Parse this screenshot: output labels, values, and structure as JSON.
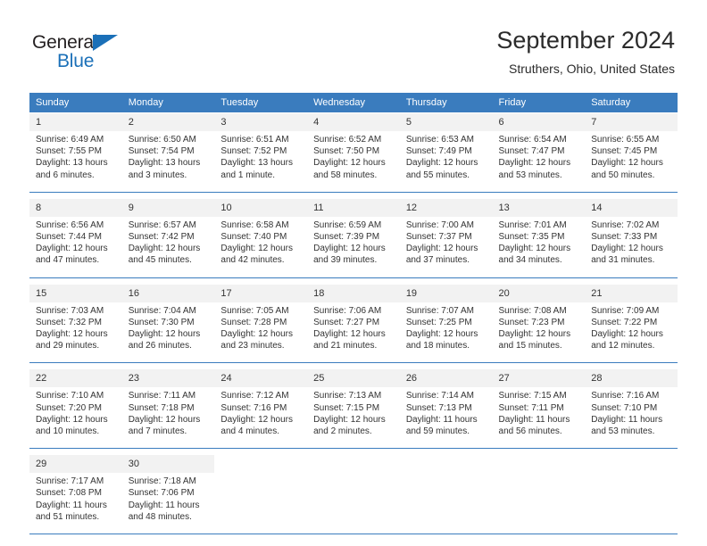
{
  "logo": {
    "text_primary": "General",
    "text_secondary": "Blue",
    "triangle_icon": "triangle-icon",
    "brand_color": "#1b70b8"
  },
  "header": {
    "title": "September 2024",
    "subtitle": "Struthers, Ohio, United States"
  },
  "theme": {
    "header_bg": "#3a7cbe",
    "daynum_bg": "#f2f2f2",
    "cell_bg": "#ffffff",
    "text": "#333333",
    "separator": "#3a7cbe"
  },
  "calendar": {
    "columns": [
      "Sunday",
      "Monday",
      "Tuesday",
      "Wednesday",
      "Thursday",
      "Friday",
      "Saturday"
    ],
    "weeks": [
      [
        {
          "day": "1",
          "sunrise": "Sunrise: 6:49 AM",
          "sunset": "Sunset: 7:55 PM",
          "daylight_1": "Daylight: 13 hours",
          "daylight_2": "and 6 minutes."
        },
        {
          "day": "2",
          "sunrise": "Sunrise: 6:50 AM",
          "sunset": "Sunset: 7:54 PM",
          "daylight_1": "Daylight: 13 hours",
          "daylight_2": "and 3 minutes."
        },
        {
          "day": "3",
          "sunrise": "Sunrise: 6:51 AM",
          "sunset": "Sunset: 7:52 PM",
          "daylight_1": "Daylight: 13 hours",
          "daylight_2": "and 1 minute."
        },
        {
          "day": "4",
          "sunrise": "Sunrise: 6:52 AM",
          "sunset": "Sunset: 7:50 PM",
          "daylight_1": "Daylight: 12 hours",
          "daylight_2": "and 58 minutes."
        },
        {
          "day": "5",
          "sunrise": "Sunrise: 6:53 AM",
          "sunset": "Sunset: 7:49 PM",
          "daylight_1": "Daylight: 12 hours",
          "daylight_2": "and 55 minutes."
        },
        {
          "day": "6",
          "sunrise": "Sunrise: 6:54 AM",
          "sunset": "Sunset: 7:47 PM",
          "daylight_1": "Daylight: 12 hours",
          "daylight_2": "and 53 minutes."
        },
        {
          "day": "7",
          "sunrise": "Sunrise: 6:55 AM",
          "sunset": "Sunset: 7:45 PM",
          "daylight_1": "Daylight: 12 hours",
          "daylight_2": "and 50 minutes."
        }
      ],
      [
        {
          "day": "8",
          "sunrise": "Sunrise: 6:56 AM",
          "sunset": "Sunset: 7:44 PM",
          "daylight_1": "Daylight: 12 hours",
          "daylight_2": "and 47 minutes."
        },
        {
          "day": "9",
          "sunrise": "Sunrise: 6:57 AM",
          "sunset": "Sunset: 7:42 PM",
          "daylight_1": "Daylight: 12 hours",
          "daylight_2": "and 45 minutes."
        },
        {
          "day": "10",
          "sunrise": "Sunrise: 6:58 AM",
          "sunset": "Sunset: 7:40 PM",
          "daylight_1": "Daylight: 12 hours",
          "daylight_2": "and 42 minutes."
        },
        {
          "day": "11",
          "sunrise": "Sunrise: 6:59 AM",
          "sunset": "Sunset: 7:39 PM",
          "daylight_1": "Daylight: 12 hours",
          "daylight_2": "and 39 minutes."
        },
        {
          "day": "12",
          "sunrise": "Sunrise: 7:00 AM",
          "sunset": "Sunset: 7:37 PM",
          "daylight_1": "Daylight: 12 hours",
          "daylight_2": "and 37 minutes."
        },
        {
          "day": "13",
          "sunrise": "Sunrise: 7:01 AM",
          "sunset": "Sunset: 7:35 PM",
          "daylight_1": "Daylight: 12 hours",
          "daylight_2": "and 34 minutes."
        },
        {
          "day": "14",
          "sunrise": "Sunrise: 7:02 AM",
          "sunset": "Sunset: 7:33 PM",
          "daylight_1": "Daylight: 12 hours",
          "daylight_2": "and 31 minutes."
        }
      ],
      [
        {
          "day": "15",
          "sunrise": "Sunrise: 7:03 AM",
          "sunset": "Sunset: 7:32 PM",
          "daylight_1": "Daylight: 12 hours",
          "daylight_2": "and 29 minutes."
        },
        {
          "day": "16",
          "sunrise": "Sunrise: 7:04 AM",
          "sunset": "Sunset: 7:30 PM",
          "daylight_1": "Daylight: 12 hours",
          "daylight_2": "and 26 minutes."
        },
        {
          "day": "17",
          "sunrise": "Sunrise: 7:05 AM",
          "sunset": "Sunset: 7:28 PM",
          "daylight_1": "Daylight: 12 hours",
          "daylight_2": "and 23 minutes."
        },
        {
          "day": "18",
          "sunrise": "Sunrise: 7:06 AM",
          "sunset": "Sunset: 7:27 PM",
          "daylight_1": "Daylight: 12 hours",
          "daylight_2": "and 21 minutes."
        },
        {
          "day": "19",
          "sunrise": "Sunrise: 7:07 AM",
          "sunset": "Sunset: 7:25 PM",
          "daylight_1": "Daylight: 12 hours",
          "daylight_2": "and 18 minutes."
        },
        {
          "day": "20",
          "sunrise": "Sunrise: 7:08 AM",
          "sunset": "Sunset: 7:23 PM",
          "daylight_1": "Daylight: 12 hours",
          "daylight_2": "and 15 minutes."
        },
        {
          "day": "21",
          "sunrise": "Sunrise: 7:09 AM",
          "sunset": "Sunset: 7:22 PM",
          "daylight_1": "Daylight: 12 hours",
          "daylight_2": "and 12 minutes."
        }
      ],
      [
        {
          "day": "22",
          "sunrise": "Sunrise: 7:10 AM",
          "sunset": "Sunset: 7:20 PM",
          "daylight_1": "Daylight: 12 hours",
          "daylight_2": "and 10 minutes."
        },
        {
          "day": "23",
          "sunrise": "Sunrise: 7:11 AM",
          "sunset": "Sunset: 7:18 PM",
          "daylight_1": "Daylight: 12 hours",
          "daylight_2": "and 7 minutes."
        },
        {
          "day": "24",
          "sunrise": "Sunrise: 7:12 AM",
          "sunset": "Sunset: 7:16 PM",
          "daylight_1": "Daylight: 12 hours",
          "daylight_2": "and 4 minutes."
        },
        {
          "day": "25",
          "sunrise": "Sunrise: 7:13 AM",
          "sunset": "Sunset: 7:15 PM",
          "daylight_1": "Daylight: 12 hours",
          "daylight_2": "and 2 minutes."
        },
        {
          "day": "26",
          "sunrise": "Sunrise: 7:14 AM",
          "sunset": "Sunset: 7:13 PM",
          "daylight_1": "Daylight: 11 hours",
          "daylight_2": "and 59 minutes."
        },
        {
          "day": "27",
          "sunrise": "Sunrise: 7:15 AM",
          "sunset": "Sunset: 7:11 PM",
          "daylight_1": "Daylight: 11 hours",
          "daylight_2": "and 56 minutes."
        },
        {
          "day": "28",
          "sunrise": "Sunrise: 7:16 AM",
          "sunset": "Sunset: 7:10 PM",
          "daylight_1": "Daylight: 11 hours",
          "daylight_2": "and 53 minutes."
        }
      ],
      [
        {
          "day": "29",
          "sunrise": "Sunrise: 7:17 AM",
          "sunset": "Sunset: 7:08 PM",
          "daylight_1": "Daylight: 11 hours",
          "daylight_2": "and 51 minutes."
        },
        {
          "day": "30",
          "sunrise": "Sunrise: 7:18 AM",
          "sunset": "Sunset: 7:06 PM",
          "daylight_1": "Daylight: 11 hours",
          "daylight_2": "and 48 minutes."
        },
        {
          "day": "",
          "sunrise": "",
          "sunset": "",
          "daylight_1": "",
          "daylight_2": ""
        },
        {
          "day": "",
          "sunrise": "",
          "sunset": "",
          "daylight_1": "",
          "daylight_2": ""
        },
        {
          "day": "",
          "sunrise": "",
          "sunset": "",
          "daylight_1": "",
          "daylight_2": ""
        },
        {
          "day": "",
          "sunrise": "",
          "sunset": "",
          "daylight_1": "",
          "daylight_2": ""
        },
        {
          "day": "",
          "sunrise": "",
          "sunset": "",
          "daylight_1": "",
          "daylight_2": ""
        }
      ]
    ]
  }
}
